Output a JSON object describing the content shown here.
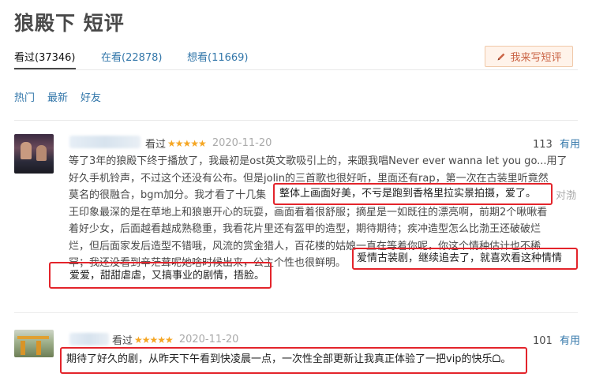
{
  "page": {
    "title": "狼殿下 短评"
  },
  "tabs": [
    {
      "label": "看过(37346)"
    },
    {
      "label": "在看(22878)"
    },
    {
      "label": "想看(11669)"
    }
  ],
  "write_button": {
    "label": "我来写短评",
    "icon": "pencil-icon"
  },
  "filters": [
    {
      "label": "热门"
    },
    {
      "label": "最新"
    },
    {
      "label": "好友"
    }
  ],
  "comments": [
    {
      "status": "看过",
      "stars": "★★★★★",
      "date": "2020-11-20",
      "votes": "113",
      "useful_label": "有用",
      "lines": [
        "等了3年的狼殿下终于播放了，我最初是ost英文歌吸引上的，来跟我唱Never ever wanna let you go...用了",
        "好久手机铃声，不过这个还没有公布。但是jolin的三首歌也很好听，里面还有rap，第一次在古装里听竟然",
        "莫名的很融合，bgm加分。我才看了十几集",
        "王印象最深的是在草地上和狼崽开心的玩耍，画面看着很舒服；摘星是一如既往的漂亮啊，前期2个啾啾看",
        "着好少女，后面越看越成熟稳重，我看花片里还有盔甲的造型，期待期待；疾冲造型怎么比渤王还破破烂",
        "烂，但后面家发后造型不错哦，风流的赏金猎人，百花楼的姑娘一直在等着你呢，你这个情种估计也不稀",
        "罕；我还没看到辛茫茸呢她啥时候出来，公主个性也很鲜明。"
      ],
      "highlights": [
        "整体上画面好美，不亏是跑到香格里拉实景拍摄，爱了。",
        "爱情古装剧，继续追去了，就喜欢看这种情情",
        "爱爱，甜甜虐虐，又搞事业的剧情，捂脸。"
      ],
      "tail_text": "对渤"
    },
    {
      "status": "看过",
      "stars": "★★★★★",
      "date": "2020-11-20",
      "votes": "101",
      "useful_label": "有用",
      "highlights": [
        "期待了好久的剧，从昨天下午看到快凌晨一点，一次性全部更新让我真正体验了一把vip的快乐ᗝ。"
      ]
    }
  ]
}
